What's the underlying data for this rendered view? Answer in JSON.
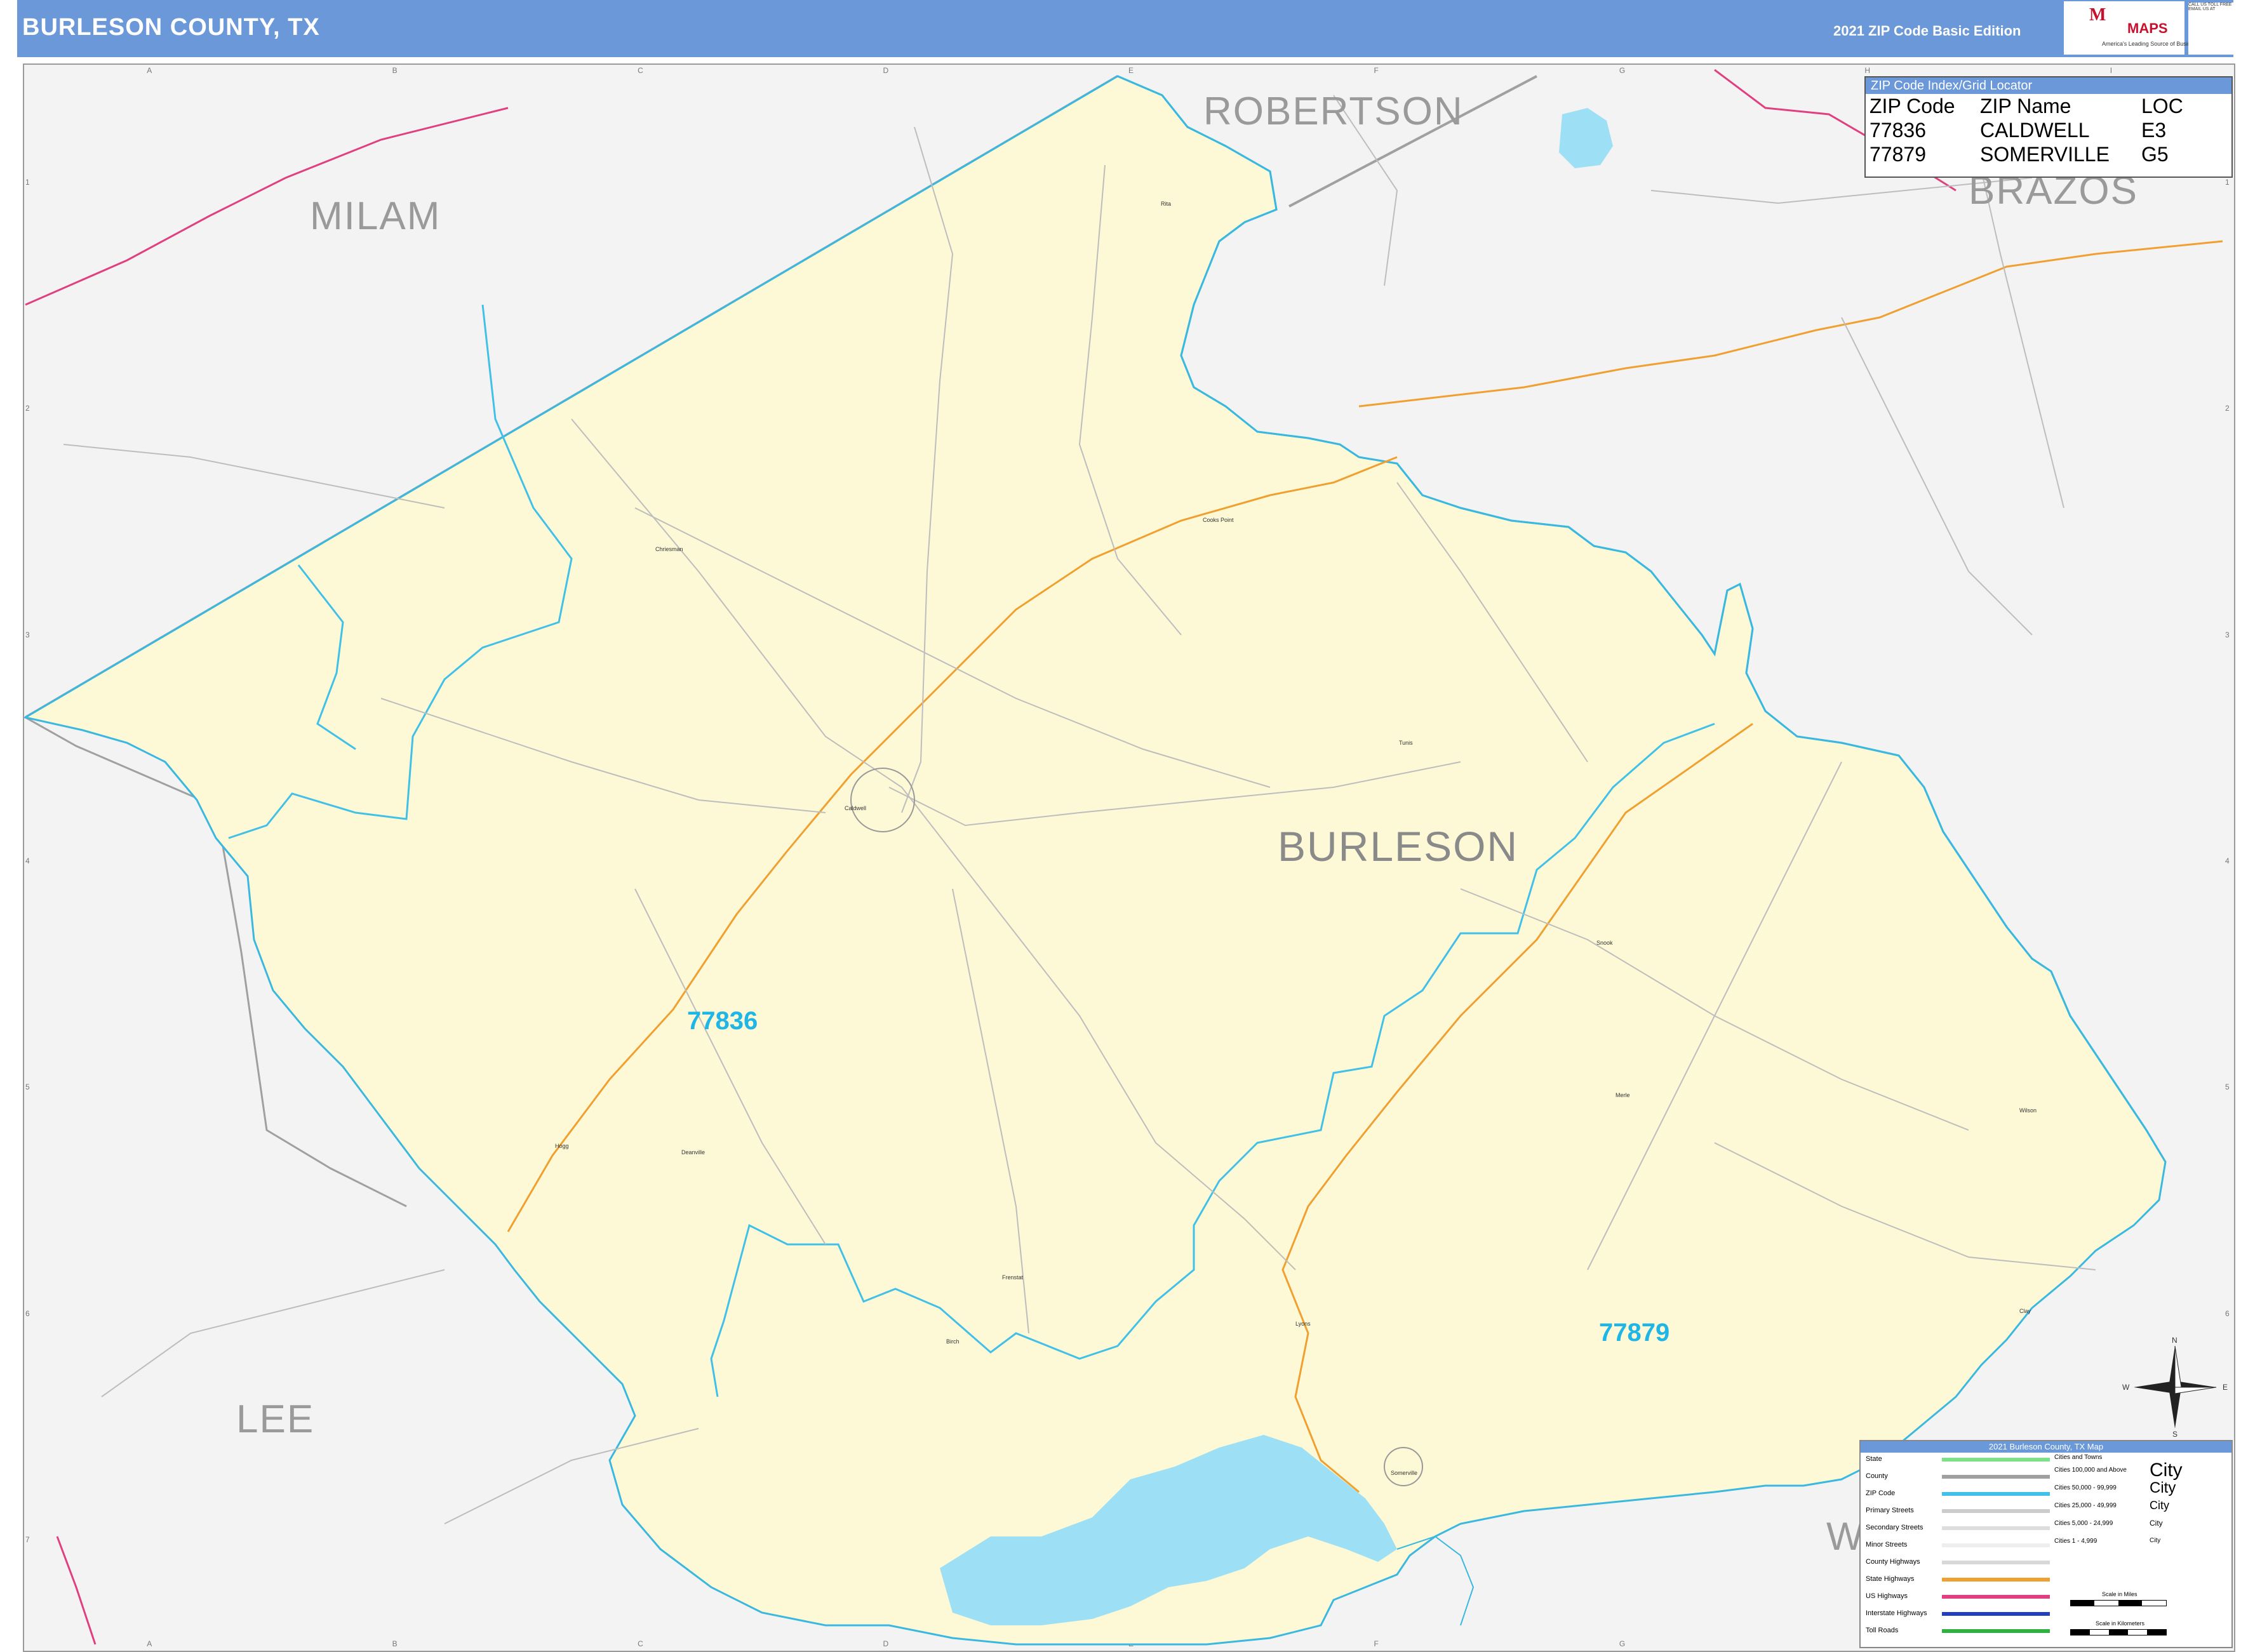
{
  "header": {
    "title": "BURLESON COUNTY, TX",
    "edition": "2021 ZIP Code Basic Edition",
    "logo_text_1": "M",
    "logo_text_2": "MAPS",
    "logo_tagline": "America's Leading Source of Business Maps",
    "contact_1": "CALL US TOLL FREE",
    "contact_2": "EMAIL US AT"
  },
  "grid": {
    "columns": [
      "A",
      "B",
      "C",
      "D",
      "E",
      "F",
      "G",
      "H",
      "I"
    ],
    "rows": [
      "1",
      "2",
      "3",
      "4",
      "5",
      "6",
      "7"
    ]
  },
  "counties": {
    "main": "BURLESON",
    "neighbors": [
      {
        "id": "robertson",
        "name": "ROBERTSON"
      },
      {
        "id": "brazos",
        "name": "BRAZOS"
      },
      {
        "id": "milam",
        "name": "MILAM"
      },
      {
        "id": "lee",
        "name": "LEE"
      },
      {
        "id": "washington",
        "name": "W"
      }
    ]
  },
  "zip_labels": [
    "77836",
    "77879"
  ],
  "places": [
    "Chriesman",
    "Cooks Point",
    "Caldwell",
    "Snook",
    "Tunis",
    "Somerville",
    "Deanville",
    "Frenstat",
    "Lyons",
    "Birch",
    "Hogg",
    "Rita",
    "Merle",
    "Wilson",
    "Clay"
  ],
  "zip_index": {
    "title": "ZIP Code Index/Grid Locator",
    "columns": [
      "ZIP Code",
      "ZIP Name",
      "LOC"
    ],
    "rows": [
      [
        "77836",
        "CALDWELL",
        "E3"
      ],
      [
        "77879",
        "SOMERVILLE",
        "G5"
      ]
    ]
  },
  "legend": {
    "title": "2021 Burleson County, TX Map",
    "items": [
      {
        "label": "State",
        "color": "#7fe08a"
      },
      {
        "label": "County",
        "color": "#a0a0a0"
      },
      {
        "label": "ZIP Code",
        "color": "#41c0e8"
      },
      {
        "label": "Primary Streets",
        "color": "#cccccc"
      },
      {
        "label": "Secondary Streets",
        "color": "#dddddd"
      },
      {
        "label": "Minor Streets",
        "color": "#eeeeee"
      },
      {
        "label": "County Highways",
        "color": "#d8d8d8"
      },
      {
        "label": "State Highways",
        "color": "#f0a030"
      },
      {
        "label": "US Highways",
        "color": "#e04080"
      },
      {
        "label": "Interstate Highways",
        "color": "#2040c0"
      },
      {
        "label": "Toll Roads",
        "color": "#30b040"
      }
    ],
    "cities_title": "Cities and Towns",
    "cities": [
      {
        "label": "Cities 100,000 and Above",
        "sample": "City"
      },
      {
        "label": "Cities 50,000 - 99,999",
        "sample": "City"
      },
      {
        "label": "Cities 25,000 - 49,999",
        "sample": "City"
      },
      {
        "label": "Cities 5,000 - 24,999",
        "sample": "City"
      },
      {
        "label": "Cities 1 - 4,999",
        "sample": "City"
      }
    ],
    "scale_miles": "Scale in Miles",
    "scale_km": "Scale in Kilometers"
  },
  "compass": {
    "n": "N",
    "s": "S",
    "e": "E",
    "w": "W"
  },
  "colors": {
    "header": "#6a98d8",
    "county_fill": "#fdf9d6",
    "outside": "#f3f3f3",
    "zip_boundary": "#41c0e8",
    "river": "#3ab8e0",
    "water": "#9de0f5",
    "state_hwy": "#f0a030",
    "us_hwy": "#e04080",
    "county_line": "#a0a0a0",
    "roads": "#bdbdbd"
  }
}
